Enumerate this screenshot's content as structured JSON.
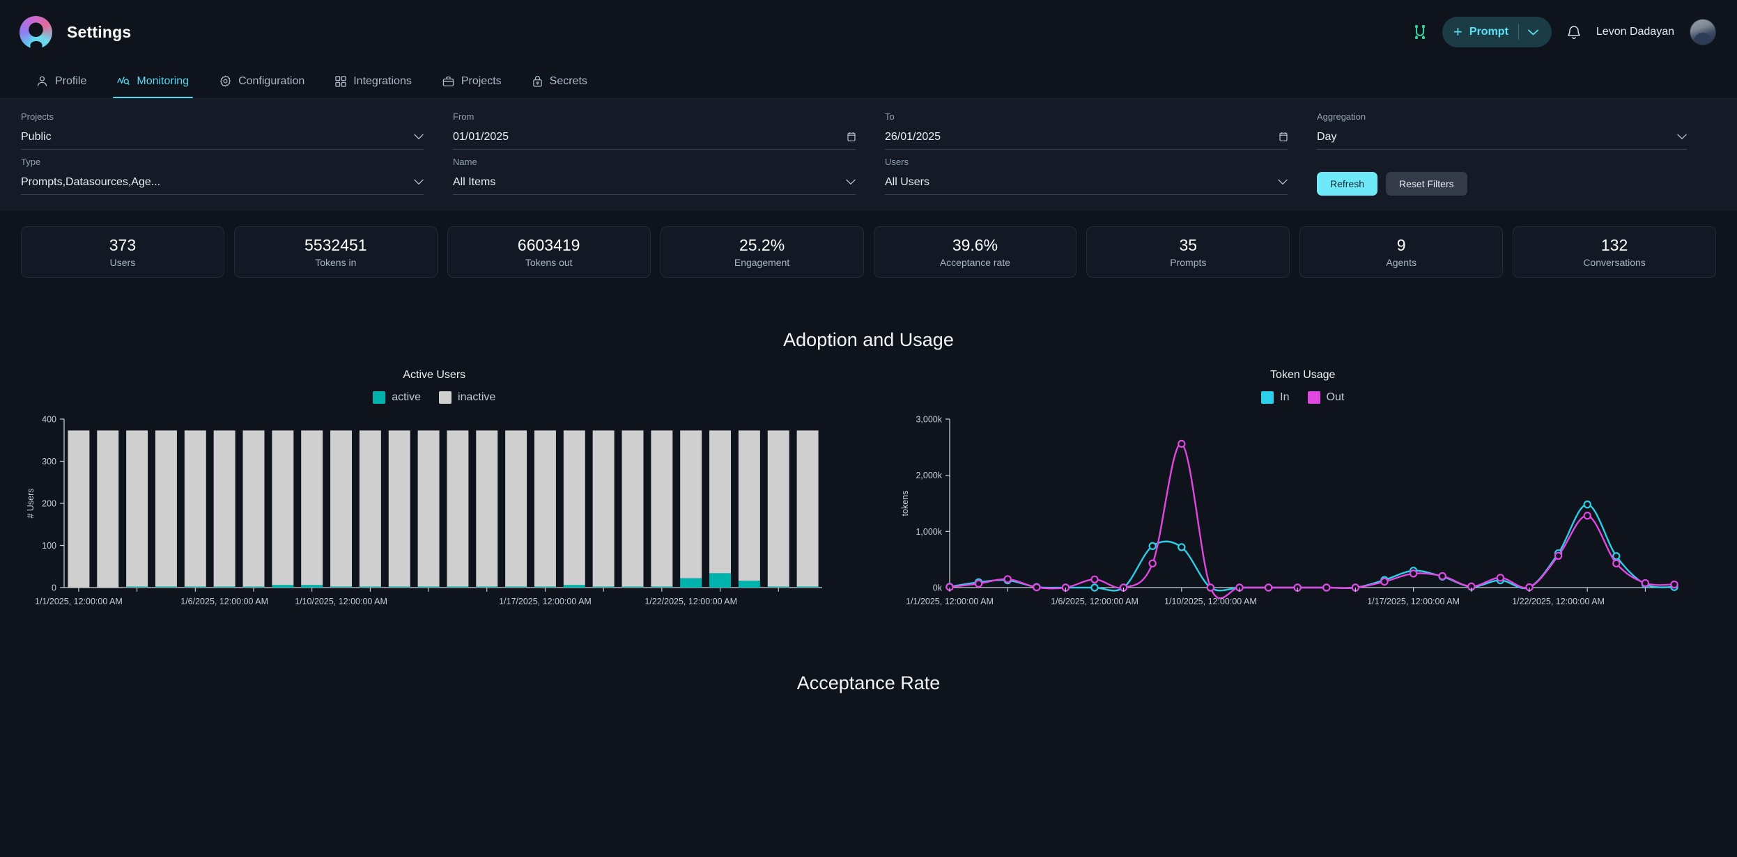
{
  "header": {
    "app_title": "Settings",
    "logo_icon": "app-logo-gradient",
    "connections_icon": "plug-connection-icon",
    "prompt_button": {
      "plus": "+",
      "label": "Prompt",
      "chevron_icon": "chevron-down-icon"
    },
    "bell_icon": "notification-bell-icon",
    "user_name": "Levon Dadayan",
    "avatar_icon": "user-avatar"
  },
  "tabs": [
    {
      "label": "Profile",
      "icon": "user-icon",
      "active": false
    },
    {
      "label": "Monitoring",
      "icon": "activity-chart-icon",
      "active": true
    },
    {
      "label": "Configuration",
      "icon": "gear-icon",
      "active": false
    },
    {
      "label": "Integrations",
      "icon": "grid-squares-icon",
      "active": false
    },
    {
      "label": "Projects",
      "icon": "briefcase-icon",
      "active": false
    },
    {
      "label": "Secrets",
      "icon": "lock-icon",
      "active": false
    }
  ],
  "filters": {
    "projects": {
      "label": "Projects",
      "value": "Public",
      "icon": "chevron-down-icon"
    },
    "from": {
      "label": "From",
      "value": "01/01/2025",
      "icon": "calendar-icon"
    },
    "to": {
      "label": "To",
      "value": "26/01/2025",
      "icon": "calendar-icon"
    },
    "aggregation": {
      "label": "Aggregation",
      "value": "Day",
      "icon": "chevron-down-icon"
    },
    "type": {
      "label": "Type",
      "value": "Prompts,Datasources,Age...",
      "icon": "chevron-down-icon"
    },
    "name": {
      "label": "Name",
      "value": "All Items",
      "icon": "chevron-down-icon"
    },
    "users": {
      "label": "Users",
      "value": "All Users",
      "icon": "chevron-down-icon"
    },
    "refresh_button": "Refresh",
    "reset_button": "Reset Filters"
  },
  "kpis": [
    {
      "value": "373",
      "label": "Users"
    },
    {
      "value": "5532451",
      "label": "Tokens in"
    },
    {
      "value": "6603419",
      "label": "Tokens out"
    },
    {
      "value": "25.2%",
      "label": "Engagement"
    },
    {
      "value": "39.6%",
      "label": "Acceptance rate"
    },
    {
      "value": "35",
      "label": "Prompts"
    },
    {
      "value": "9",
      "label": "Agents"
    },
    {
      "value": "132",
      "label": "Conversations"
    }
  ],
  "sections": {
    "adoption_and_usage": "Adoption and Usage",
    "acceptance_rate": "Acceptance Rate"
  },
  "colors": {
    "accent_cyan": "#56d8f0",
    "teal_active": "#00b3ad",
    "gray_inactive": "#cfcfcf",
    "magenta_out": "#e046e0",
    "cyan_in": "#2bd0e8",
    "primary_button": "#6fe8fa",
    "green_plug": "#34d399"
  },
  "chart_data": [
    {
      "type": "bar",
      "title": "Active Users",
      "xlabel": "",
      "ylabel": "# Users",
      "ylim": [
        0,
        400
      ],
      "yticks": [
        0,
        100,
        200,
        300,
        400
      ],
      "ytick_labels": [
        "0",
        "100",
        "200",
        "300",
        "400"
      ],
      "stacked": true,
      "grid": false,
      "legend_position": "top",
      "legend": [
        "active",
        "inactive"
      ],
      "x_tick_labels": [
        "1/1/2025, 12:00:00 AM",
        "1/6/2025, 12:00:00 AM",
        "1/10/2025, 12:00:00 AM",
        "1/17/2025, 12:00:00 AM",
        "1/22/2025, 12:00:00 AM"
      ],
      "x_tick_index": [
        0,
        5,
        9,
        16,
        21
      ],
      "categories": [
        "1/1/2025",
        "1/2/2025",
        "1/3/2025",
        "1/4/2025",
        "1/5/2025",
        "1/6/2025",
        "1/7/2025",
        "1/8/2025",
        "1/9/2025",
        "1/10/2025",
        "1/11/2025",
        "1/12/2025",
        "1/13/2025",
        "1/14/2025",
        "1/15/2025",
        "1/16/2025",
        "1/17/2025",
        "1/18/2025",
        "1/19/2025",
        "1/20/2025",
        "1/21/2025",
        "1/22/2025",
        "1/23/2025",
        "1/24/2025",
        "1/25/2025",
        "1/26/2025"
      ],
      "series": [
        {
          "name": "active",
          "color": "#00b3ad",
          "values": [
            0,
            0,
            2,
            2,
            2,
            2,
            2,
            6,
            6,
            2,
            2,
            2,
            2,
            2,
            2,
            2,
            2,
            6,
            2,
            2,
            2,
            22,
            34,
            16,
            2,
            2
          ]
        },
        {
          "name": "inactive",
          "color": "#cfcfcf",
          "values": [
            373,
            373,
            371,
            371,
            371,
            371,
            371,
            367,
            367,
            371,
            371,
            371,
            371,
            371,
            371,
            371,
            371,
            367,
            371,
            371,
            371,
            351,
            339,
            357,
            371,
            371
          ]
        }
      ]
    },
    {
      "type": "line",
      "title": "Token Usage",
      "xlabel": "",
      "ylabel": "tokens",
      "ylim": [
        0,
        3000000
      ],
      "yticks": [
        0,
        1000000,
        2000000,
        3000000
      ],
      "ytick_labels": [
        "0k",
        "1,000k",
        "2,000k",
        "3,000k"
      ],
      "grid": false,
      "legend_position": "top",
      "legend": [
        "In",
        "Out"
      ],
      "markers": "circle",
      "x_tick_labels": [
        "1/1/2025, 12:00:00 AM",
        "1/6/2025, 12:00:00 AM",
        "1/10/2025, 12:00:00 AM",
        "1/17/2025, 12:00:00 AM",
        "1/22/2025, 12:00:00 AM"
      ],
      "x_tick_index": [
        0,
        5,
        9,
        16,
        21
      ],
      "x": [
        "1/1/2025",
        "1/2/2025",
        "1/3/2025",
        "1/4/2025",
        "1/5/2025",
        "1/6/2025",
        "1/7/2025",
        "1/8/2025",
        "1/9/2025",
        "1/10/2025",
        "1/11/2025",
        "1/12/2025",
        "1/13/2025",
        "1/14/2025",
        "1/15/2025",
        "1/16/2025",
        "1/17/2025",
        "1/18/2025",
        "1/19/2025",
        "1/20/2025",
        "1/21/2025",
        "1/22/2025",
        "1/23/2025",
        "1/24/2025",
        "1/25/2025",
        "1/26/2025"
      ],
      "series": [
        {
          "name": "In",
          "color": "#2bd0e8",
          "values": [
            15000,
            95000,
            130000,
            10000,
            0,
            0,
            0,
            740000,
            720000,
            0,
            0,
            0,
            0,
            0,
            0,
            135000,
            300000,
            195000,
            15000,
            130000,
            5000,
            610000,
            1480000,
            560000,
            60000,
            10000
          ]
        },
        {
          "name": "Out",
          "color": "#e046e0",
          "values": [
            10000,
            70000,
            150000,
            5000,
            0,
            145000,
            0,
            430000,
            2560000,
            0,
            0,
            0,
            0,
            0,
            0,
            105000,
            250000,
            205000,
            20000,
            175000,
            5000,
            565000,
            1280000,
            430000,
            80000,
            55000
          ]
        }
      ]
    }
  ]
}
